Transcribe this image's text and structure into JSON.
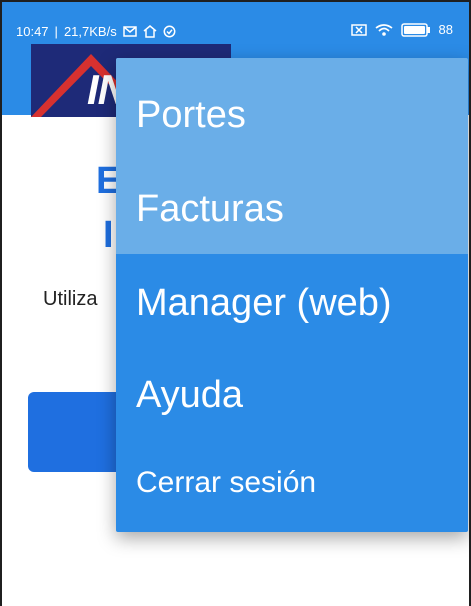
{
  "status_bar": {
    "time": "10:47",
    "separator": "|",
    "network_speed": "21,7KB/s",
    "battery_level": "88",
    "icons": [
      "mail-icon",
      "home-icon",
      "check-circle-icon",
      "close-box-icon",
      "wifi-icon",
      "battery-icon"
    ]
  },
  "app": {
    "logo_text": "IN",
    "colors": {
      "appbar": "#2b8be6",
      "logo_background": "#1e2a78",
      "logo_accent": "#d7312f"
    }
  },
  "content": {
    "heading_fragment_1": "E",
    "heading_fragment_2": "I",
    "body_fragment": "Utiliza"
  },
  "menu": {
    "items": [
      {
        "label": "Portes",
        "highlighted": true
      },
      {
        "label": "Facturas",
        "highlighted": true
      },
      {
        "label": "Manager (web)",
        "highlighted": false
      },
      {
        "label": "Ayuda",
        "highlighted": false
      },
      {
        "label": "Cerrar sesión",
        "highlighted": false
      }
    ],
    "colors": {
      "background": "#2b8be6",
      "highlight": "#6aaee8",
      "text": "#ffffff"
    }
  }
}
